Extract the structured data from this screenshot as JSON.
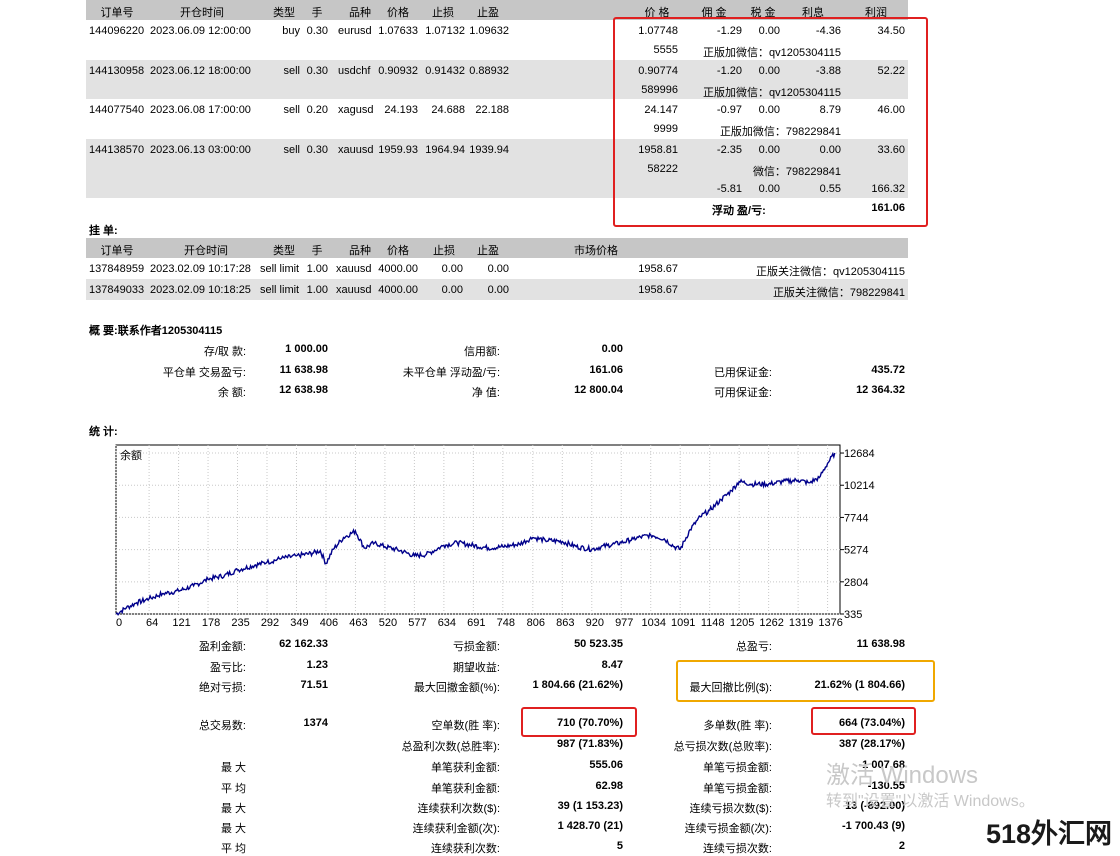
{
  "positions": {
    "headers": [
      "订单号",
      "开仓时间",
      "类型",
      "手",
      "品种",
      "价格",
      "止损",
      "止盈",
      "价 格",
      "佣 金",
      "税 金",
      "利息",
      "利润"
    ],
    "rows": [
      {
        "ticket": "144096220",
        "time": "2023.06.09 12:00:00",
        "type": "buy",
        "lots": "0.30",
        "symbol": "eurusd",
        "price": "1.07633",
        "sl": "1.07132",
        "tp": "1.09632",
        "cur_price": "1.07748",
        "commission": "-1.29",
        "taxes": "0.00",
        "swap": "-4.36",
        "profit": "34.50",
        "sub_num": "5555",
        "sub_note": "正版加微信：qv1205304115"
      },
      {
        "ticket": "144130958",
        "time": "2023.06.12 18:00:00",
        "type": "sell",
        "lots": "0.30",
        "symbol": "usdchf",
        "price": "0.90932",
        "sl": "0.91432",
        "tp": "0.88932",
        "cur_price": "0.90774",
        "commission": "-1.20",
        "taxes": "0.00",
        "swap": "-3.88",
        "profit": "52.22",
        "sub_num": "589996",
        "sub_note": "正版加微信：qv1205304115"
      },
      {
        "ticket": "144077540",
        "time": "2023.06.08 17:00:00",
        "type": "sell",
        "lots": "0.20",
        "symbol": "xagusd",
        "price": "24.193",
        "sl": "24.688",
        "tp": "22.188",
        "cur_price": "24.147",
        "commission": "-0.97",
        "taxes": "0.00",
        "swap": "8.79",
        "profit": "46.00",
        "sub_num": "9999",
        "sub_note": "正版加微信：798229841"
      },
      {
        "ticket": "144138570",
        "time": "2023.06.13 03:00:00",
        "type": "sell",
        "lots": "0.30",
        "symbol": "xauusd",
        "price": "1959.93",
        "sl": "1964.94",
        "tp": "1939.94",
        "cur_price": "1958.81",
        "commission": "-2.35",
        "taxes": "0.00",
        "swap": "0.00",
        "profit": "33.60",
        "sub_num": "58222",
        "sub_note": "微信：798229841"
      }
    ],
    "totals": {
      "commission": "-5.81",
      "taxes": "0.00",
      "swap": "0.55",
      "profit": "166.32"
    },
    "floating_label": "浮动 盈/亏:",
    "floating_value": "161.06"
  },
  "pending": {
    "title": "挂 单:",
    "headers": [
      "订单号",
      "开仓时间",
      "类型",
      "手",
      "品种",
      "价格",
      "止损",
      "止盈",
      "市场价格"
    ],
    "rows": [
      {
        "ticket": "137848959",
        "time": "2023.02.09 10:17:28",
        "type": "sell limit",
        "lots": "1.00",
        "symbol": "xauusd",
        "price": "4000.00",
        "sl": "0.00",
        "tp": "0.00",
        "market": "1958.67",
        "note": "正版关注微信：qv1205304115"
      },
      {
        "ticket": "137849033",
        "time": "2023.02.09 10:18:25",
        "type": "sell limit",
        "lots": "1.00",
        "symbol": "xauusd",
        "price": "4000.00",
        "sl": "0.00",
        "tp": "0.00",
        "market": "1958.67",
        "note": "正版关注微信：798229841"
      }
    ]
  },
  "summary": {
    "title": "概 要:联系作者1205304115",
    "deposit_label": "存/取 款:",
    "deposit": "1 000.00",
    "credit_label": "信用额:",
    "credit": "0.00",
    "closed_pl_label": "平仓单 交易盈亏:",
    "closed_pl": "11 638.98",
    "floating_pl_label": "未平仓单 浮动盈/亏:",
    "floating_pl": "161.06",
    "margin_label": "已用保证金:",
    "margin": "435.72",
    "balance_label": "余 额:",
    "balance": "12 638.98",
    "equity_label": "净 值:",
    "equity": "12 800.04",
    "free_margin_label": "可用保证金:",
    "free_margin": "12 364.32"
  },
  "stats_title": "统 计:",
  "chart_data": {
    "type": "line",
    "title": "余额",
    "y_ticks": [
      12684,
      10214,
      7744,
      5274,
      2804,
      335
    ],
    "x_ticks": [
      0,
      64,
      121,
      178,
      235,
      292,
      349,
      406,
      463,
      520,
      577,
      634,
      691,
      748,
      806,
      863,
      920,
      977,
      1034,
      1091,
      1148,
      1205,
      1262,
      1319,
      1376
    ],
    "xlim": [
      0,
      1400
    ],
    "ylim": [
      335,
      13300
    ],
    "grid": true,
    "line_color": "#00008b",
    "series": [
      {
        "x": [
          0,
          20,
          40,
          64,
          90,
          121,
          150,
          178,
          210,
          235,
          270,
          292,
          320,
          349,
          380,
          395,
          406,
          420,
          440,
          463,
          480,
          500,
          520,
          550,
          577,
          600,
          634,
          660,
          691,
          720,
          748,
          780,
          806,
          830,
          863,
          890,
          920,
          950,
          977,
          1000,
          1034,
          1060,
          1080,
          1091,
          1110,
          1130,
          1148,
          1170,
          1190,
          1205,
          1230,
          1262,
          1290,
          1319,
          1340,
          1360,
          1376,
          1390
        ],
        "y": [
          335,
          800,
          1200,
          1500,
          1900,
          2100,
          2500,
          3000,
          3300,
          3700,
          4100,
          4300,
          4600,
          4800,
          5000,
          5200,
          4200,
          5300,
          6200,
          6700,
          5400,
          5800,
          5500,
          5200,
          4800,
          4900,
          5600,
          5800,
          5600,
          5400,
          5500,
          5700,
          6200,
          6000,
          5900,
          5500,
          5300,
          5600,
          5800,
          6100,
          6400,
          6100,
          5500,
          5300,
          6800,
          7800,
          8300,
          9100,
          9800,
          10500,
          10300,
          10300,
          10500,
          10600,
          10400,
          10800,
          11900,
          12684
        ]
      }
    ]
  },
  "stats": {
    "gross_profit_label": "盈利金额:",
    "gross_profit": "62 162.33",
    "gross_loss_label": "亏损金额:",
    "gross_loss": "50 523.35",
    "total_net_label": "总盈亏:",
    "total_net": "11 638.98",
    "profit_factor_label": "盈亏比:",
    "profit_factor": "1.23",
    "expected_payoff_label": "期望收益:",
    "expected_payoff": "8.47",
    "abs_drawdown_label": "绝对亏损:",
    "abs_drawdown": "71.51",
    "max_drawdown_label": "最大回撤金额(%):",
    "max_drawdown": "1 804.66 (21.62%)",
    "rel_drawdown_label": "最大回撤比例($):",
    "rel_drawdown": "21.62% (1 804.66)",
    "total_trades_label": "总交易数:",
    "total_trades": "1374",
    "short_label": "空单数(胜 率):",
    "short": "710 (70.70%)",
    "long_label": "多单数(胜 率):",
    "long": "664 (73.04%)",
    "profit_trades_label": "总盈利次数(总胜率):",
    "profit_trades": "987 (71.83%)",
    "loss_trades_label": "总亏损次数(总败率):",
    "loss_trades": "387 (28.17%)",
    "largest_label": "最 大",
    "largest_profit_label": "单笔获利金额:",
    "largest_profit": "555.06",
    "largest_loss_label": "单笔亏损金额:",
    "largest_loss": "-1 007.68",
    "average_label": "平 均",
    "avg_profit_label": "单笔获利金额:",
    "avg_profit": "62.98",
    "avg_loss_label": "单笔亏损金额:",
    "avg_loss": "-130.55",
    "max_label": "最 大",
    "cons_wins_label": "连续获利次数($):",
    "cons_wins": "39 (1 153.23)",
    "cons_losses_label": "连续亏损次数($):",
    "cons_losses": "13 (-892.00)",
    "max2_label": "最 大",
    "cons_profit_label": "连续获利金额(次):",
    "cons_profit": "1 428.70 (21)",
    "cons_loss_label": "连续亏损金额(次):",
    "cons_loss": "-1 700.43 (9)",
    "avg2_label": "平 均",
    "avg_cons_wins_label": "连续获利次数:",
    "avg_cons_wins": "5",
    "avg_cons_losses_label": "连续亏损次数:",
    "avg_cons_losses": "2"
  },
  "watermark": {
    "activate_line1": "激活 Windows",
    "activate_line2": "转到\"设置\"以激活 Windows。",
    "brand": "518外汇网"
  }
}
